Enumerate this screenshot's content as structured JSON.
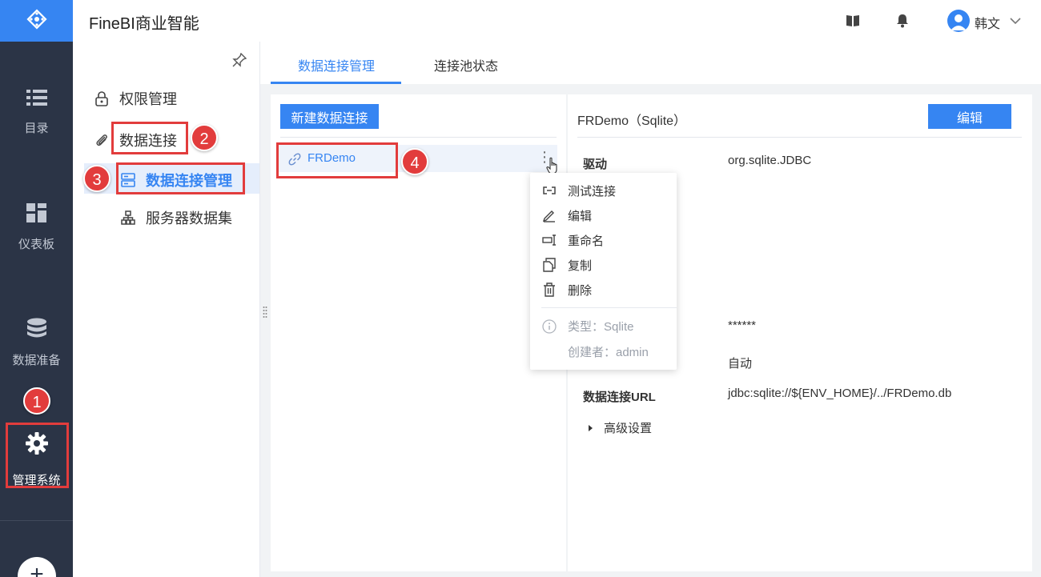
{
  "app": {
    "title": "FineBI商业智能"
  },
  "user": {
    "name": "韩文"
  },
  "nav": {
    "items": [
      {
        "label": "目录",
        "icon": "list-icon"
      },
      {
        "label": "仪表板",
        "icon": "dashboard-icon"
      },
      {
        "label": "数据准备",
        "icon": "database-icon"
      },
      {
        "label": "管理系统",
        "icon": "gear-icon"
      }
    ],
    "add_label": "+"
  },
  "sidebar": {
    "items": [
      {
        "label": "权限管理",
        "icon": "lock-icon"
      },
      {
        "label": "数据连接",
        "icon": "paperclip-icon"
      },
      {
        "label": "数据连接管理",
        "icon": "server-list-icon"
      },
      {
        "label": "服务器数据集",
        "icon": "sitemap-icon"
      }
    ]
  },
  "tabs": [
    {
      "label": "数据连接管理",
      "active": true
    },
    {
      "label": "连接池状态",
      "active": false
    }
  ],
  "connections": {
    "new_button": "新建数据连接",
    "items": [
      {
        "name": "FRDemo"
      }
    ],
    "more": "⋮"
  },
  "detail": {
    "title": "FRDemo（Sqlite）",
    "edit_button": "编辑",
    "driver_label": "驱动",
    "driver_value": "org.sqlite.JDBC",
    "password_value": "******",
    "encoding_value": "自动",
    "url_label": "数据连接URL",
    "url_value": "jdbc:sqlite://${ENV_HOME}/../FRDemo.db",
    "advanced_label": "高级设置"
  },
  "context_menu": {
    "items": [
      {
        "label": "测试连接",
        "icon": "link-test-icon"
      },
      {
        "label": "编辑",
        "icon": "pencil-icon"
      },
      {
        "label": "重命名",
        "icon": "rename-icon"
      },
      {
        "label": "复制",
        "icon": "copy-icon"
      },
      {
        "label": "删除",
        "icon": "trash-icon"
      }
    ],
    "type_info": "类型：Sqlite",
    "creator_info": "创建者：admin"
  },
  "annotations": [
    "1",
    "2",
    "3",
    "4"
  ],
  "colors": {
    "accent": "#3685f2",
    "nav_bg": "#2b3446",
    "annotation": "#e23c3c"
  }
}
